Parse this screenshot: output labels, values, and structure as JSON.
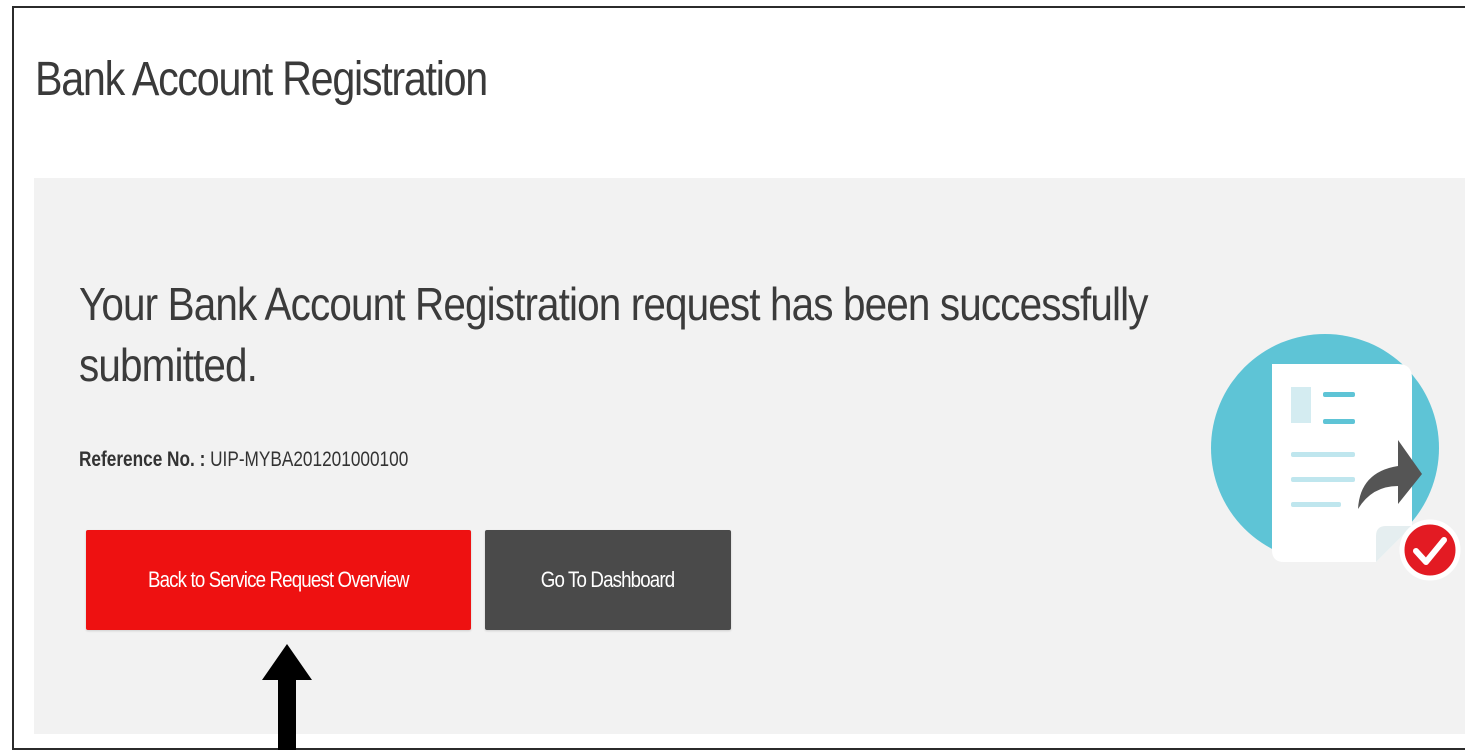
{
  "page": {
    "title": "Bank Account Registration"
  },
  "confirmation": {
    "message": "Your Bank Account Registration request has been successfully submitted.",
    "reference_label": "Reference No. :",
    "reference_value": "UIP-MYBA201201000100"
  },
  "actions": {
    "back_label": "Back to Service Request Overview",
    "dashboard_label": "Go To Dashboard"
  },
  "illustration": {
    "icon": "document-submitted-icon",
    "badge_icon": "checkmark-icon",
    "circle_color": "#5ec4d6",
    "badge_color": "#e31b23"
  },
  "annotation": {
    "icon": "up-arrow-icon"
  },
  "colors": {
    "primary_button": "#ee1111",
    "secondary_button": "#4a4a4a",
    "panel_background": "#f2f2f2"
  }
}
